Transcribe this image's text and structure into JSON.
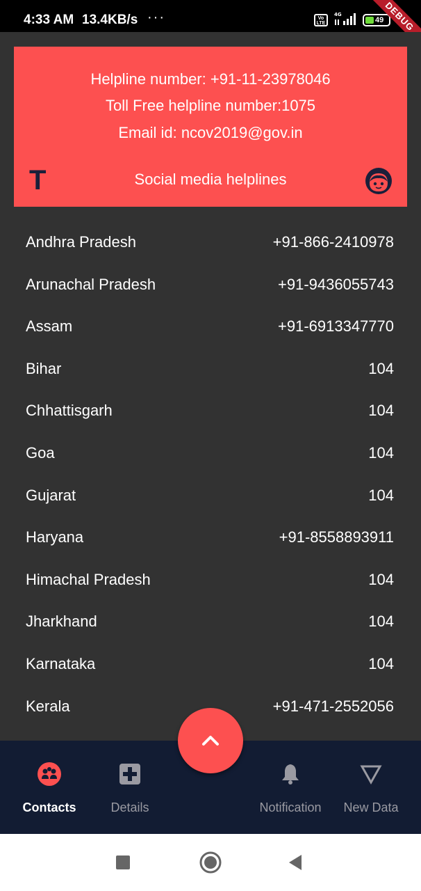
{
  "status_bar": {
    "time": "4:33 AM",
    "speed": "13.4KB/s",
    "more": "···",
    "volte": "VoLTE",
    "battery": "49",
    "debug": "DEBUG"
  },
  "helpline": {
    "line1": "Helpline number: +91-11-23978046",
    "line2": "Toll Free helpline number:1075",
    "line3": "Email id: ncov2019@gov.in",
    "social_label": "Social media helplines",
    "twitter_icon": "T"
  },
  "states": [
    {
      "name": "Andhra Pradesh",
      "number": "+91-866-2410978"
    },
    {
      "name": "Arunachal Pradesh",
      "number": "+91-9436055743"
    },
    {
      "name": "Assam",
      "number": "+91-6913347770"
    },
    {
      "name": "Bihar",
      "number": "104"
    },
    {
      "name": "Chhattisgarh",
      "number": "104"
    },
    {
      "name": "Goa",
      "number": "104"
    },
    {
      "name": "Gujarat",
      "number": "104"
    },
    {
      "name": "Haryana",
      "number": "+91-8558893911"
    },
    {
      "name": "Himachal Pradesh",
      "number": "104"
    },
    {
      "name": "Jharkhand",
      "number": "104"
    },
    {
      "name": "Karnataka",
      "number": "104"
    },
    {
      "name": "Kerala",
      "number": "+91-471-2552056"
    }
  ],
  "nav": {
    "contacts": "Contacts",
    "details": "Details",
    "notification": "Notification",
    "new_data": "New Data",
    "active": "contacts"
  },
  "colors": {
    "accent": "#fd5050",
    "background": "#323232",
    "nav_background": "#121c33"
  }
}
